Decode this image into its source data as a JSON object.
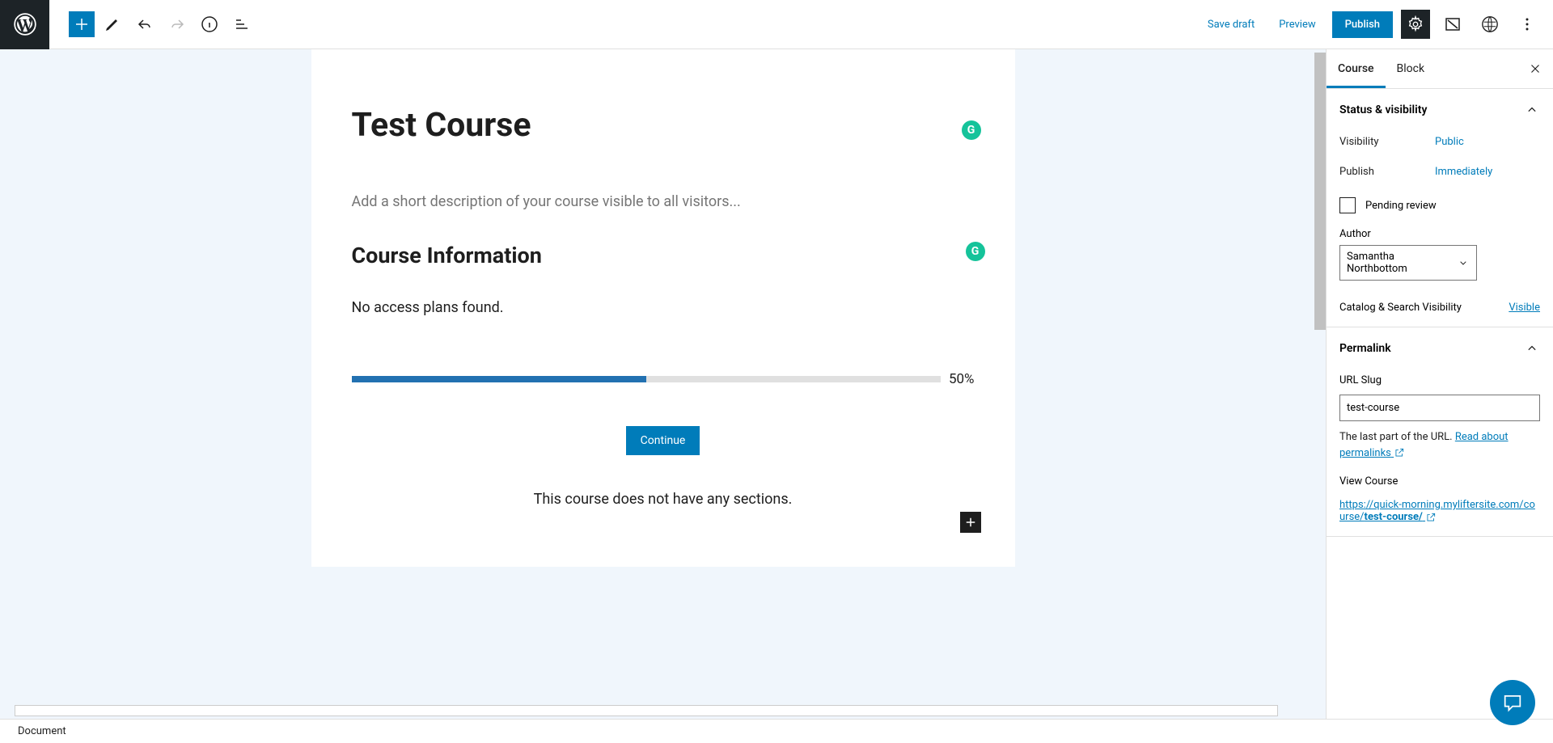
{
  "toolbar": {
    "save_draft": "Save draft",
    "preview": "Preview",
    "publish": "Publish"
  },
  "editor": {
    "title": "Test Course",
    "description_placeholder": "Add a short description of your course visible to all visitors...",
    "info_heading": "Course Information",
    "no_plans": "No access plans found.",
    "progress_percent": "50%",
    "continue_label": "Continue",
    "no_sections": "This course does not have any sections."
  },
  "sidebar": {
    "tabs": {
      "course": "Course",
      "block": "Block"
    },
    "status": {
      "heading": "Status & visibility",
      "visibility_label": "Visibility",
      "visibility_value": "Public",
      "publish_label": "Publish",
      "publish_value": "Immediately",
      "pending_review": "Pending review",
      "author_label": "Author",
      "author_value": "Samantha Northbottom",
      "catalog_label": "Catalog & Search Visibility",
      "catalog_value": "Visible"
    },
    "permalink": {
      "heading": "Permalink",
      "slug_label": "URL Slug",
      "slug_value": "test-course",
      "help1": "The last part of the URL. ",
      "help_link": "Read about permalinks",
      "view_label": "View Course",
      "url_prefix": "https://quick-morning.myliftersite.com/course/",
      "url_slug": "test-course/"
    }
  },
  "footer": {
    "breadcrumb": "Document"
  }
}
